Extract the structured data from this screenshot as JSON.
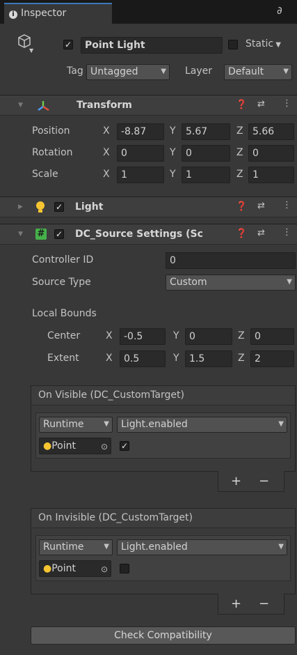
{
  "tab": {
    "label": "Inspector"
  },
  "gameobject": {
    "active": true,
    "name": "Point Light",
    "static_label": "Static",
    "tag_label": "Tag",
    "tag_value": "Untagged",
    "layer_label": "Layer",
    "layer_value": "Default"
  },
  "transform": {
    "title": "Transform",
    "rows": [
      {
        "label": "Position",
        "x": "-8.87",
        "y": "5.67",
        "z": "5.66"
      },
      {
        "label": "Rotation",
        "x": "0",
        "y": "0",
        "z": "0"
      },
      {
        "label": "Scale",
        "x": "1",
        "y": "1",
        "z": "1"
      }
    ]
  },
  "light": {
    "title": "Light",
    "enabled": true
  },
  "dc": {
    "title": "DC_Source Settings (Sc",
    "controller_label": "Controller ID",
    "controller_value": "0",
    "source_type_label": "Source Type",
    "source_type_value": "Custom",
    "local_bounds_label": "Local Bounds",
    "center": {
      "label": "Center",
      "x": "-0.5",
      "y": "0",
      "z": "0"
    },
    "extent": {
      "label": "Extent",
      "x": "0.5",
      "y": "1.5",
      "z": "2"
    }
  },
  "events": [
    {
      "title": "On Visible (DC_CustomTarget)",
      "mode": "Runtime",
      "func": "Light.enabled",
      "target": "Point",
      "checked": true
    },
    {
      "title": "On Invisible (DC_CustomTarget)",
      "mode": "Runtime",
      "func": "Light.enabled",
      "target": "Point",
      "checked": false
    }
  ],
  "axis_labels": {
    "x": "X",
    "y": "Y",
    "z": "Z"
  },
  "plus": "+",
  "minus": "−",
  "check_button": "Check Compatibility"
}
